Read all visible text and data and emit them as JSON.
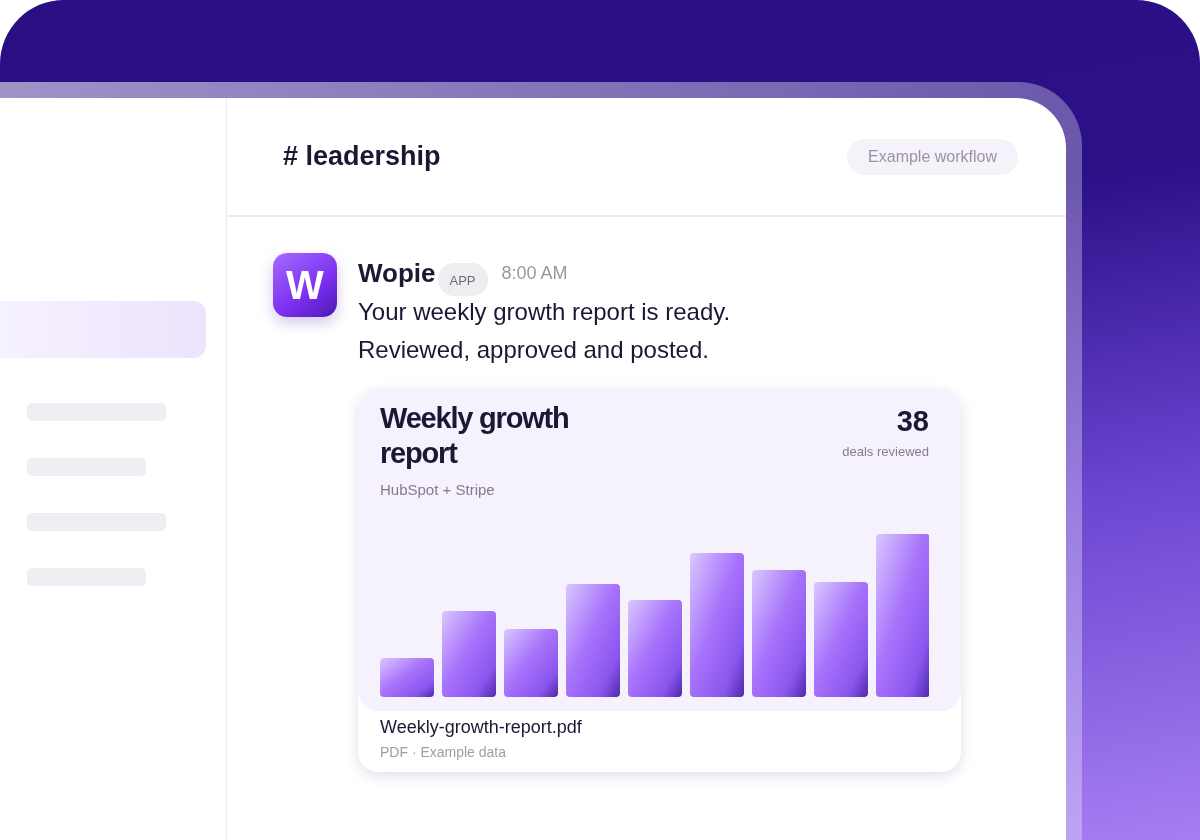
{
  "sidebar": {
    "items": [
      {
        "selected": true
      },
      {
        "selected": false
      },
      {
        "selected": false
      },
      {
        "selected": false
      },
      {
        "selected": false
      }
    ]
  },
  "channel": {
    "title": "# leadership",
    "badge": "Example workflow"
  },
  "message": {
    "avatar_letter": "W",
    "sender": "Wopie",
    "sender_badge": "APP",
    "time": "8:00 AM",
    "lines": [
      "Your weekly growth report is ready.",
      "Reviewed, approved and posted."
    ],
    "attachment": {
      "title": "Weekly growth report",
      "count": "38",
      "count_label": "deals reviewed",
      "source": "HubSpot + Stripe",
      "kind": "picture",
      "file_name": "Weekly-growth-report.pdf",
      "file_meta": "PDF · Example data"
    }
  }
}
